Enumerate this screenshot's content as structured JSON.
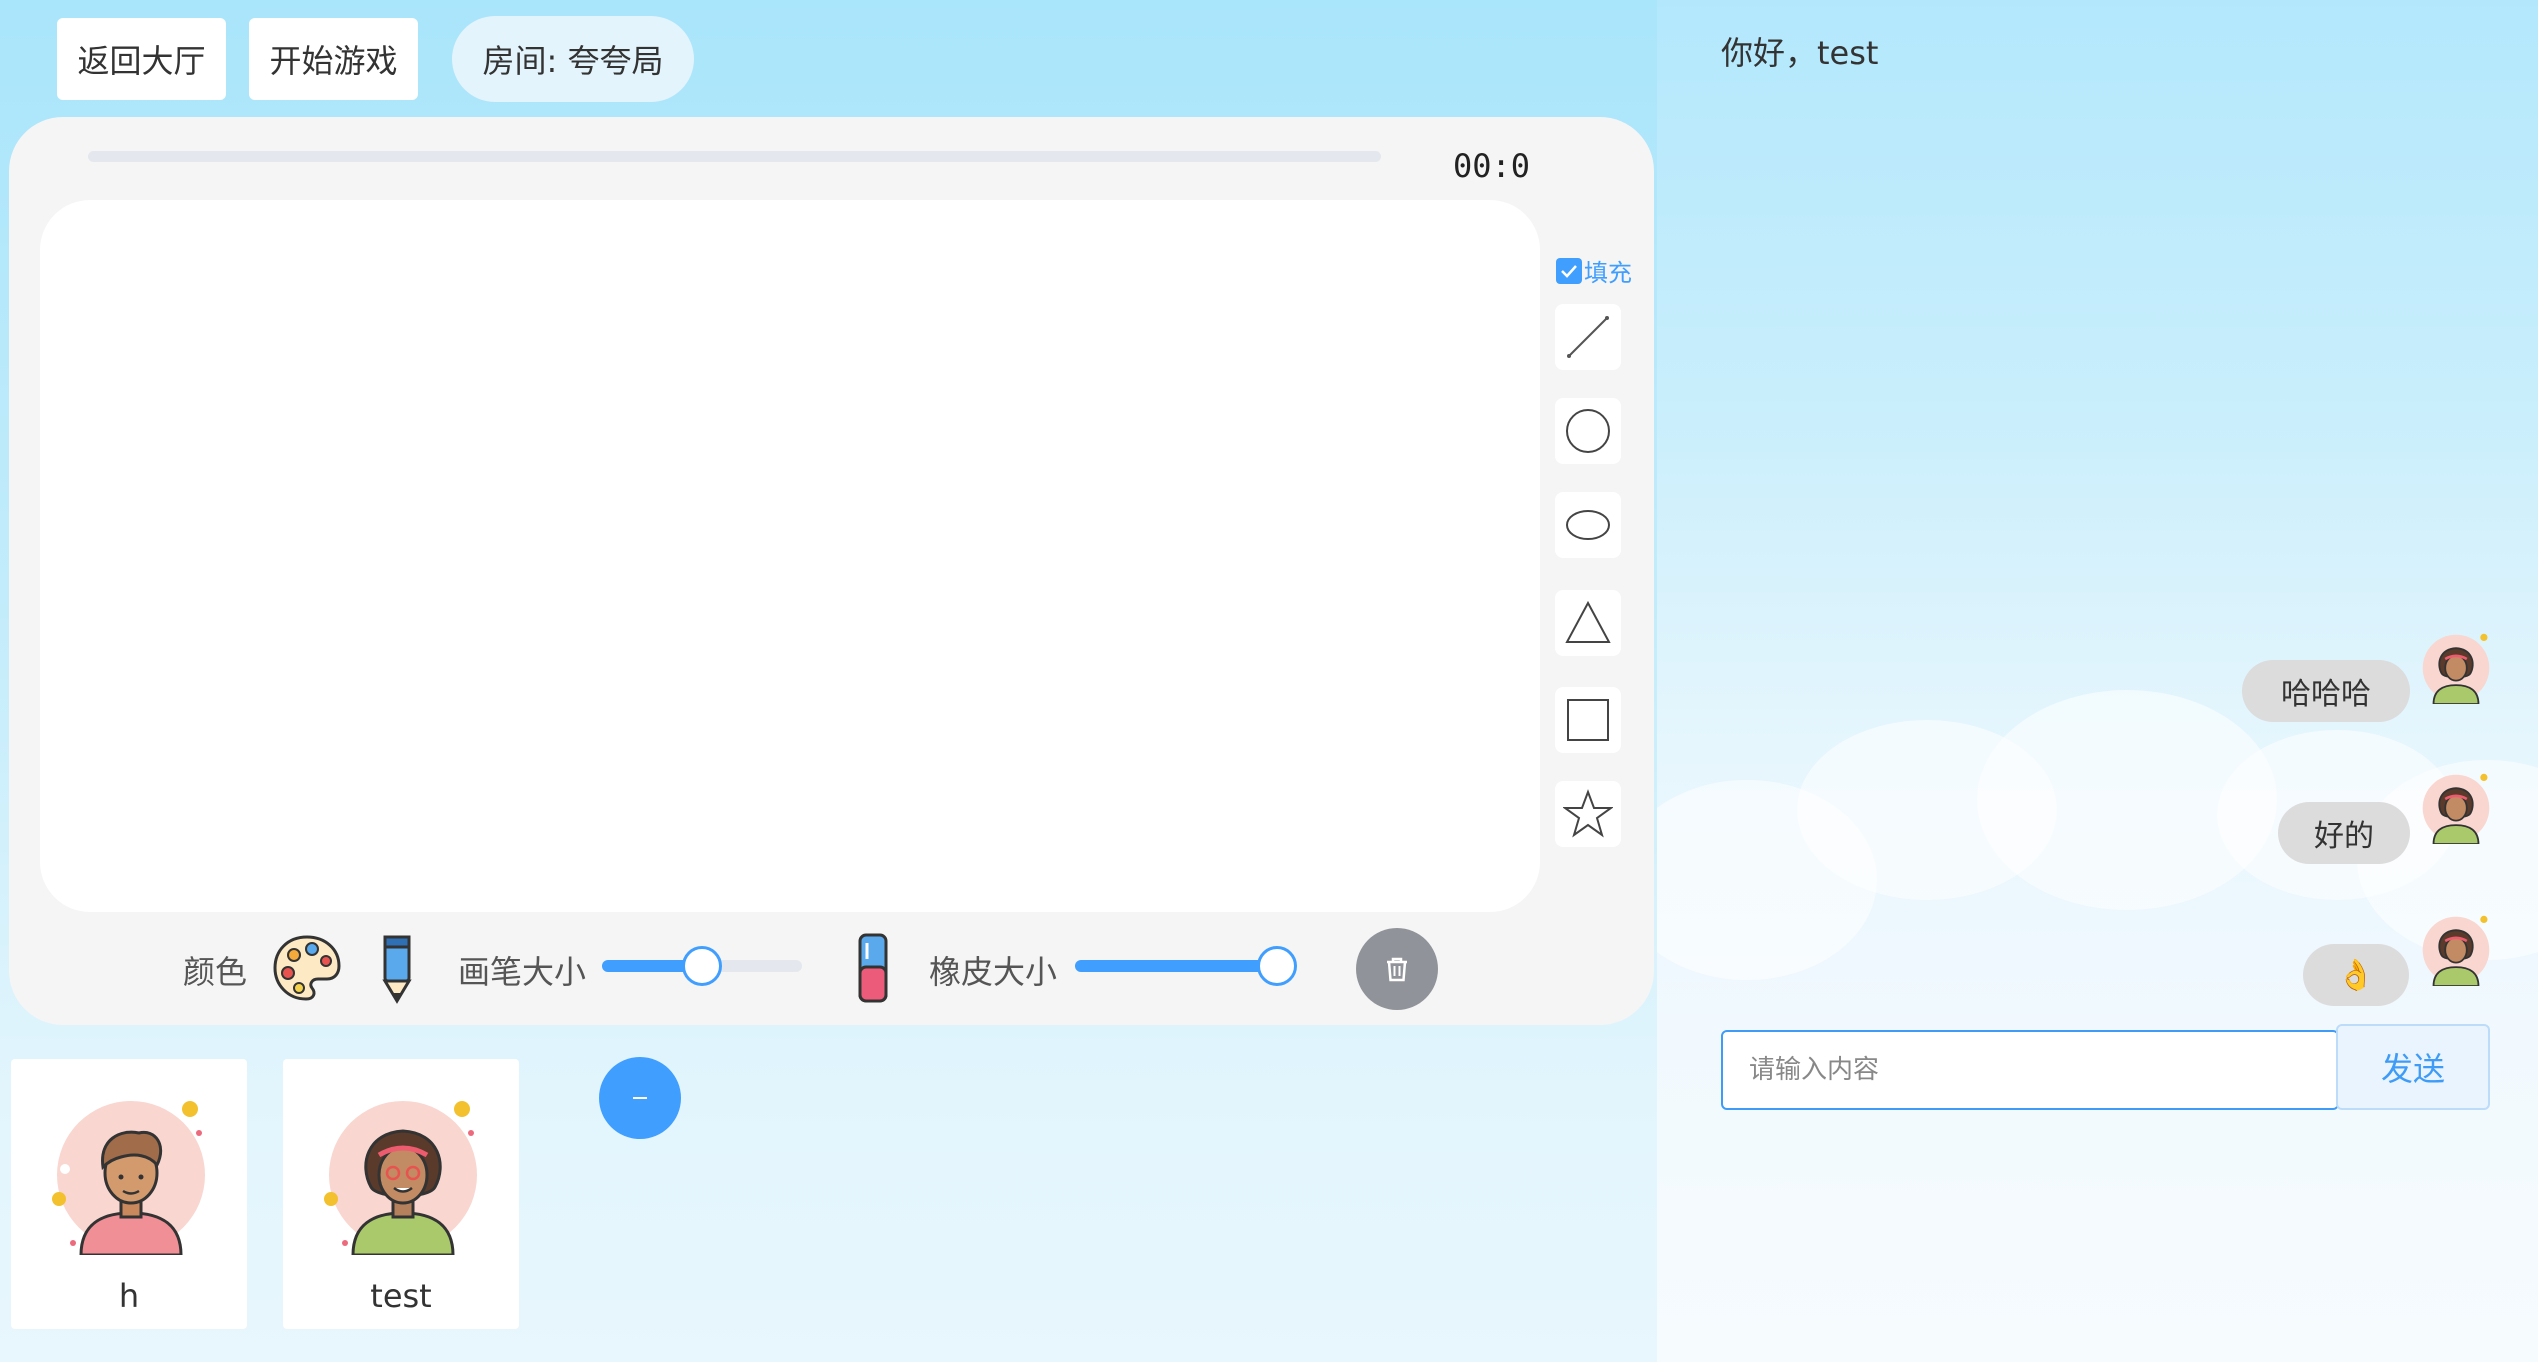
{
  "header": {
    "back_label": "返回大厅",
    "start_label": "开始游戏",
    "room_label": "房间: 夸夸局"
  },
  "board": {
    "timer": "00:0",
    "progress": 0,
    "fill_label": "填充",
    "fill_checked": true,
    "shapes": [
      "line-tool",
      "circle-tool",
      "ellipse-tool",
      "triangle-tool",
      "rectangle-tool",
      "star-tool"
    ]
  },
  "toolbar": {
    "color_label": "颜色",
    "brush_size_label": "画笔大小",
    "brush_size_value": 0.5,
    "eraser_size_label": "橡皮大小",
    "eraser_size_value": 1.0
  },
  "players": [
    {
      "name": "h"
    },
    {
      "name": "test"
    }
  ],
  "chat": {
    "greeting": "你好，test",
    "messages": [
      {
        "text": "哈哈哈"
      },
      {
        "text": "好的"
      },
      {
        "text": "👌"
      }
    ],
    "input_placeholder": "请输入内容",
    "send_label": "发送"
  },
  "colors": {
    "accent": "#409eff",
    "board_bg": "#f5f5f5",
    "clear_button": "#909399"
  }
}
